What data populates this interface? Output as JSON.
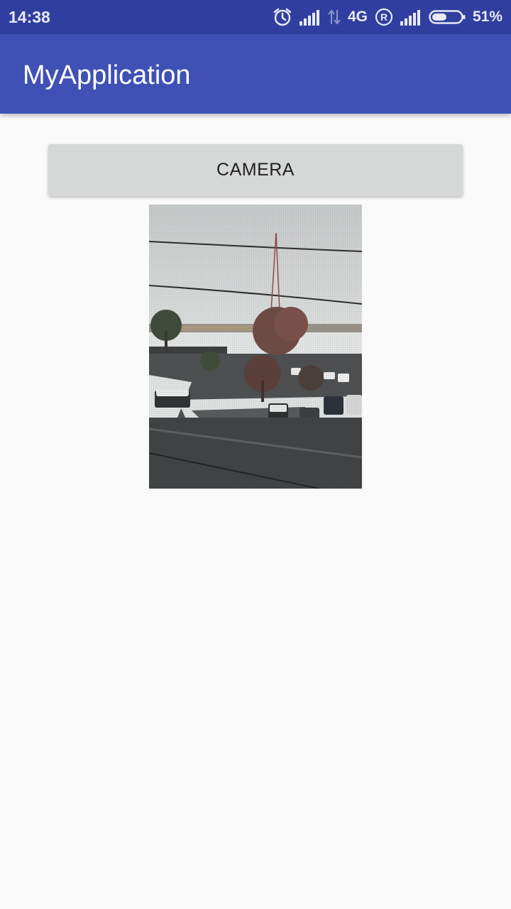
{
  "status_bar": {
    "time": "14:38",
    "network": "4G",
    "battery_percent": "51%",
    "battery_level": 0.51,
    "icons": [
      "alarm-icon",
      "signal-icon",
      "data-transfer-icon",
      "roaming-icon",
      "signal-icon",
      "battery-icon"
    ]
  },
  "app_bar": {
    "title": "MyApplication",
    "color": "#3f51b5"
  },
  "main": {
    "camera_button_label": "CAMERA",
    "photo": {
      "description_icon": "captured-photo"
    }
  },
  "colors": {
    "status_bar": "#303f9f",
    "app_bar": "#3f51b5",
    "background": "#fafafa",
    "button": "#d6d7d7"
  }
}
